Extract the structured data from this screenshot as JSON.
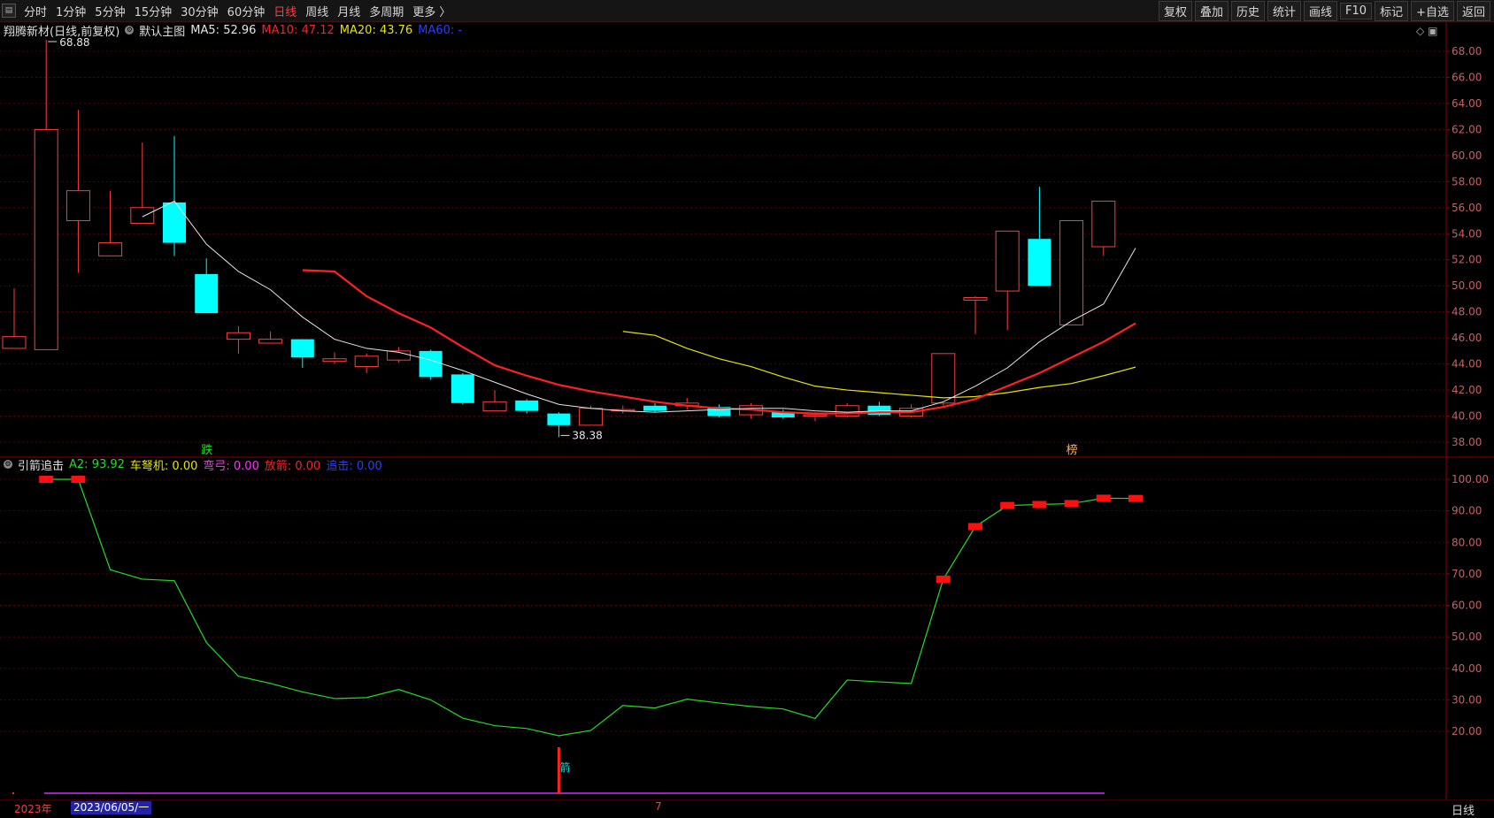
{
  "toolbar": {
    "periods": [
      "分时",
      "1分钟",
      "5分钟",
      "15分钟",
      "30分钟",
      "60分钟",
      "日线",
      "周线",
      "月线",
      "多周期",
      "更多 〉"
    ],
    "active_period_index": 6,
    "actions": [
      "复权",
      "叠加",
      "历史",
      "统计",
      "画线",
      "F10",
      "标记",
      "+自选",
      "返回"
    ]
  },
  "main_legend": {
    "title": "翔腾新材(日线,前复权)",
    "indicator": "默认主图",
    "ma5": "MA5: 52.96",
    "ma10": "MA10: 47.12",
    "ma20": "MA20: 43.76",
    "ma60": "MA60: -"
  },
  "sub_legend": {
    "name": "引箭追击",
    "a2": "A2: 93.92",
    "che": "车弩机: 0.00",
    "wan": "弯弓: 0.00",
    "fang": "放箭: 0.00",
    "zhui": "追击: 0.00"
  },
  "bottom": {
    "year": "2023年",
    "date": "2023/06/05/一",
    "cursor": "7",
    "period": "日线"
  },
  "colors": {
    "up": "#ff3c3c",
    "down": "#00ffff",
    "ma5": "#e6e6e6",
    "ma10": "#ff2020",
    "ma20": "#e6e600",
    "ma60": "#2a3cff",
    "a2": "#22dd22",
    "grid": "#5a0000"
  },
  "chart_data": {
    "type": "candlestick",
    "price_axis": {
      "min": 38,
      "max": 68,
      "ticks": [
        "38.00",
        "40.00",
        "42.00",
        "44.00",
        "46.00",
        "48.00",
        "50.00",
        "52.00",
        "54.00",
        "56.00",
        "58.00",
        "60.00",
        "62.00",
        "64.00",
        "66.00",
        "68.00"
      ]
    },
    "candles": [
      {
        "o": 45.2,
        "c": 46.1,
        "h": 49.8,
        "l": 45.2
      },
      {
        "o": 45.1,
        "c": 62.0,
        "h": 68.88,
        "l": 45.1
      },
      {
        "o": 55.0,
        "c": 57.3,
        "h": 63.5,
        "l": 51.0
      },
      {
        "o": 52.3,
        "c": 53.3,
        "h": 57.3,
        "l": 52.3
      },
      {
        "o": 54.8,
        "c": 56.0,
        "h": 61.0,
        "l": 54.8
      },
      {
        "o": 56.4,
        "c": 53.3,
        "h": 61.5,
        "l": 52.3
      },
      {
        "o": 50.9,
        "c": 47.9,
        "h": 52.1,
        "l": 47.9
      },
      {
        "o": 45.9,
        "c": 46.4,
        "h": 46.9,
        "l": 44.8
      },
      {
        "o": 45.6,
        "c": 45.9,
        "h": 46.5,
        "l": 45.6
      },
      {
        "o": 45.9,
        "c": 44.5,
        "h": 45.9,
        "l": 43.7
      },
      {
        "o": 44.2,
        "c": 44.4,
        "h": 44.9,
        "l": 44.0
      },
      {
        "o": 43.8,
        "c": 44.6,
        "h": 44.8,
        "l": 43.3
      },
      {
        "o": 44.3,
        "c": 45.0,
        "h": 45.3,
        "l": 44.1
      },
      {
        "o": 45.0,
        "c": 43.0,
        "h": 45.1,
        "l": 42.8
      },
      {
        "o": 43.2,
        "c": 41.0,
        "h": 43.3,
        "l": 40.9
      },
      {
        "o": 40.4,
        "c": 41.1,
        "h": 42.0,
        "l": 40.4
      },
      {
        "o": 41.2,
        "c": 40.4,
        "h": 41.3,
        "l": 40.2
      },
      {
        "o": 40.2,
        "c": 39.3,
        "h": 40.3,
        "l": 38.38
      },
      {
        "o": 39.3,
        "c": 40.6,
        "h": 40.8,
        "l": 39.3
      },
      {
        "o": 40.4,
        "c": 40.5,
        "h": 40.8,
        "l": 40.2
      },
      {
        "o": 40.8,
        "c": 40.4,
        "h": 41.0,
        "l": 40.3
      },
      {
        "o": 40.8,
        "c": 41.0,
        "h": 41.4,
        "l": 40.5
      },
      {
        "o": 40.7,
        "c": 40.0,
        "h": 40.9,
        "l": 39.9
      },
      {
        "o": 40.1,
        "c": 40.8,
        "h": 41.0,
        "l": 39.8
      },
      {
        "o": 40.3,
        "c": 39.9,
        "h": 40.5,
        "l": 39.8
      },
      {
        "o": 40.0,
        "c": 40.1,
        "h": 40.3,
        "l": 39.6
      },
      {
        "o": 40.0,
        "c": 40.8,
        "h": 41.0,
        "l": 39.9
      },
      {
        "o": 40.8,
        "c": 40.1,
        "h": 41.1,
        "l": 40.0
      },
      {
        "o": 40.0,
        "c": 40.6,
        "h": 40.9,
        "l": 39.9
      },
      {
        "o": 41.0,
        "c": 44.8,
        "h": 44.8,
        "l": 40.8
      },
      {
        "o": 48.9,
        "c": 49.1,
        "h": 49.2,
        "l": 46.3
      },
      {
        "o": 49.6,
        "c": 54.2,
        "h": 54.2,
        "l": 46.6
      },
      {
        "o": 53.6,
        "c": 50.0,
        "h": 57.6,
        "l": 50.0
      },
      {
        "o": 47.0,
        "c": 55.0,
        "h": 55.0,
        "l": 47.0
      },
      {
        "o": 53.0,
        "c": 56.5,
        "h": 56.5,
        "l": 52.3
      }
    ],
    "ma5": [
      null,
      null,
      null,
      null,
      55.3,
      56.5,
      53.2,
      51.1,
      49.7,
      47.6,
      45.9,
      45.2,
      44.9,
      44.3,
      43.5,
      42.6,
      41.7,
      40.9,
      40.6,
      40.4,
      40.3,
      40.4,
      40.5,
      40.6,
      40.6,
      40.4,
      40.3,
      40.4,
      40.4,
      41.1,
      42.3,
      43.7,
      45.7,
      47.3,
      48.6,
      52.9
    ],
    "ma10": [
      null,
      null,
      null,
      null,
      null,
      null,
      null,
      null,
      null,
      51.2,
      51.1,
      49.2,
      47.9,
      46.8,
      45.3,
      43.9,
      43.1,
      42.4,
      41.9,
      41.5,
      41.1,
      40.8,
      40.6,
      40.5,
      40.3,
      40.2,
      40.2,
      40.3,
      40.3,
      40.7,
      41.3,
      42.3,
      43.3,
      44.5,
      45.7,
      47.12
    ],
    "ma20": [
      null,
      null,
      null,
      null,
      null,
      null,
      null,
      null,
      null,
      null,
      null,
      null,
      null,
      null,
      null,
      null,
      null,
      null,
      null,
      46.5,
      46.2,
      45.2,
      44.4,
      43.8,
      43.0,
      42.3,
      42.0,
      41.8,
      41.6,
      41.4,
      41.5,
      41.8,
      42.2,
      42.5,
      43.1,
      43.76
    ],
    "ma60": [],
    "sub_axis": {
      "min": 10,
      "max": 105,
      "ticks": [
        "20.00",
        "30.00",
        "40.00",
        "50.00",
        "60.00",
        "70.00",
        "80.00",
        "90.00",
        "100.00"
      ]
    },
    "a2": [
      100,
      100,
      71.3,
      68.3,
      67.8,
      48.2,
      37.5,
      35.2,
      32.5,
      30.4,
      30.7,
      33.3,
      30.0,
      24.2,
      21.8,
      20.9,
      18.6,
      20.3,
      28.2,
      27.4,
      30.2,
      29.0,
      27.9,
      27.1,
      24.1,
      36.3,
      35.7,
      35.2,
      68.3,
      85.0,
      91.7,
      92.0,
      92.3,
      94.0,
      93.92
    ],
    "markers": {
      "a2_box_indices": [
        0,
        1,
        28,
        29,
        30,
        31,
        32,
        33,
        34
      ]
    },
    "annotations": {
      "high": "68.88",
      "low": "38.38",
      "die": "跌",
      "bang": "榜",
      "arrow": "箭"
    }
  }
}
